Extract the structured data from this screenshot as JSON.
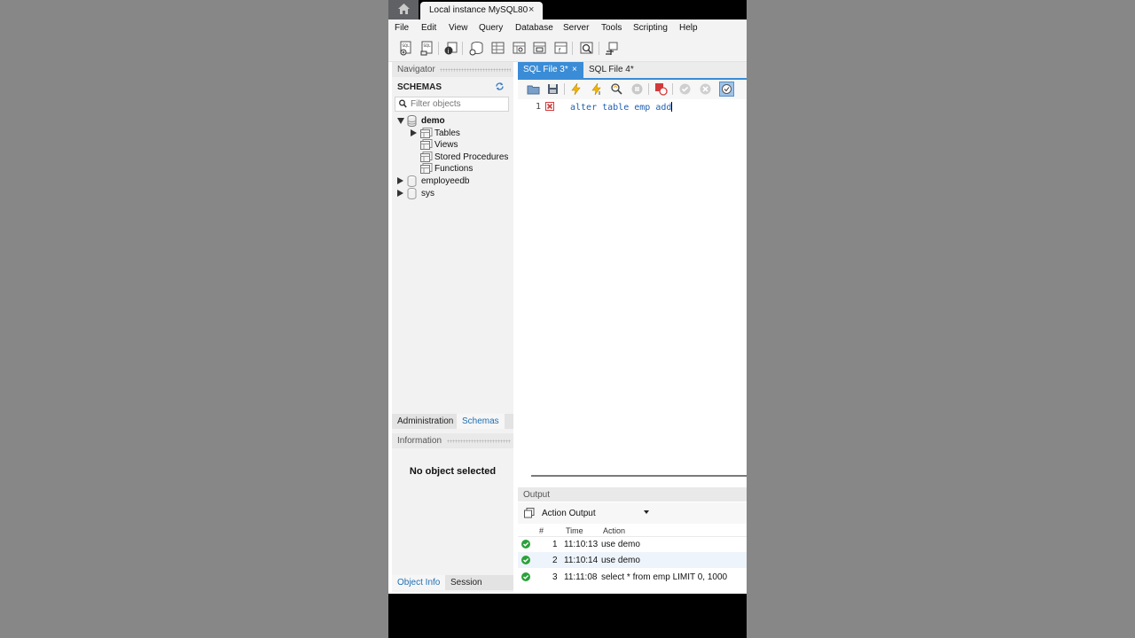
{
  "title_bar": {
    "instance_tab_label": "Local instance MySQL80",
    "close_glyph": "×"
  },
  "menu": [
    "File",
    "Edit",
    "View",
    "Query",
    "Database",
    "Server",
    "Tools",
    "Scripting",
    "Help"
  ],
  "navigator": {
    "header": "Navigator",
    "schemas_label": "SCHEMAS",
    "filter_placeholder": "Filter objects",
    "tree": {
      "demo": "demo",
      "tables": "Tables",
      "views": "Views",
      "stored_procedures": "Stored Procedures",
      "functions": "Functions",
      "employeedb": "employeedb",
      "sys": "sys"
    },
    "tabs": {
      "administration": "Administration",
      "schemas": "Schemas"
    }
  },
  "information": {
    "header": "Information",
    "message": "No object selected",
    "tabs": {
      "object_info": "Object Info",
      "session": "Session"
    }
  },
  "editor": {
    "tabs": [
      {
        "label": "SQL File 3*",
        "active": true
      },
      {
        "label": "SQL File 4*",
        "active": false
      }
    ],
    "close_glyph": "×",
    "line_number": "1",
    "code": "alter table emp add"
  },
  "output": {
    "header": "Output",
    "selector": "Action Output",
    "columns": {
      "num": "#",
      "time": "Time",
      "action": "Action"
    },
    "rows": [
      {
        "num": "1",
        "time": "11:10:13",
        "action": "use demo"
      },
      {
        "num": "2",
        "time": "11:10:14",
        "action": "use demo"
      },
      {
        "num": "3",
        "time": "11:11:08",
        "action": "select * from emp LIMIT 0, 1000"
      }
    ]
  },
  "colors": {
    "accent": "#3a8cd6",
    "ok": "#2aa13a",
    "error": "#d23a3a",
    "code": "#1f5fb0"
  }
}
